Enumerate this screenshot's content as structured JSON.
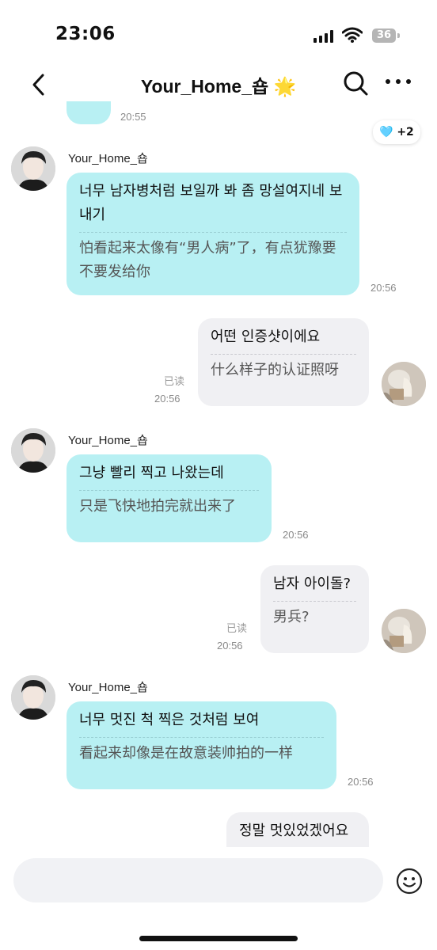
{
  "status_bar": {
    "time": "23:06",
    "battery": "36"
  },
  "header": {
    "title": "Your_Home_숍 🌟"
  },
  "reaction": {
    "emoji": "🩵",
    "count": "+2"
  },
  "messages": [
    {
      "sender": "",
      "main": "",
      "time": "20:55"
    },
    {
      "sender": "Your_Home_숍",
      "main": "너무 남자병처럼 보일까 봐 좀 망설여지네 보내기",
      "translation": "怕看起来太像有“男人病”了，有点犹豫要不要发给你",
      "time": "20:56"
    },
    {
      "main": "어떤 인증샷이에요",
      "translation": "什么样子的认证照呀",
      "read": "已读",
      "time": "20:56"
    },
    {
      "sender": "Your_Home_숍",
      "main": "그냥 빨리 찍고 나왔는데",
      "translation": "只是飞快地拍完就出来了",
      "time": "20:56"
    },
    {
      "main": "남자 아이돌?",
      "translation": "男兵?",
      "read": "已读",
      "time": "20:56"
    },
    {
      "sender": "Your_Home_숍",
      "main": "너무 멋진 척 찍은 것처럼 보여",
      "translation": "看起来却像是在故意装帅拍的一样",
      "time": "20:56"
    },
    {
      "main": "정말 멋있었겠어요"
    }
  ],
  "input": {
    "placeholder": ""
  },
  "colors": {
    "incoming_bubble": "#b8f0f3",
    "outgoing_bubble": "#f0f0f3"
  }
}
